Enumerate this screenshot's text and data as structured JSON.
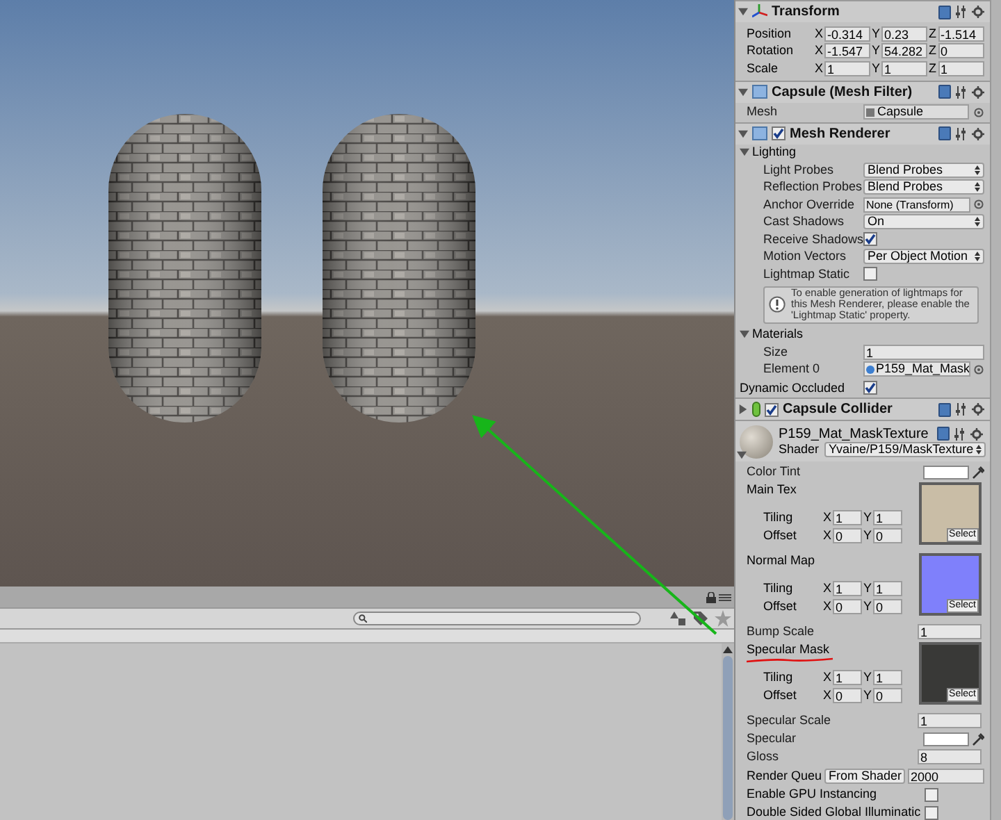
{
  "transform": {
    "title": "Transform",
    "expanded": true,
    "rows": [
      {
        "label": "Position",
        "fields": [
          {
            "axis": "X",
            "value": "-0.314"
          },
          {
            "axis": "Y",
            "value": "0.23"
          },
          {
            "axis": "Z",
            "value": "-1.514"
          }
        ]
      },
      {
        "label": "Rotation",
        "fields": [
          {
            "axis": "X",
            "value": "-1.547"
          },
          {
            "axis": "Y",
            "value": "54.282"
          },
          {
            "axis": "Z",
            "value": "0"
          }
        ]
      },
      {
        "label": "Scale",
        "fields": [
          {
            "axis": "X",
            "value": "1"
          },
          {
            "axis": "Y",
            "value": "1"
          },
          {
            "axis": "Z",
            "value": "1"
          }
        ]
      }
    ]
  },
  "mesh_filter": {
    "title": "Capsule (Mesh Filter)",
    "expanded": true,
    "mesh_label": "Mesh",
    "mesh_value": "Capsule"
  },
  "mesh_renderer": {
    "title": "Mesh Renderer",
    "expanded": true,
    "enabled": true,
    "lighting": {
      "label": "Lighting",
      "expanded": true,
      "props": [
        {
          "kind": "dropdown",
          "label": "Light Probes",
          "value": "Blend Probes"
        },
        {
          "kind": "dropdown",
          "label": "Reflection Probes",
          "value": "Blend Probes"
        },
        {
          "kind": "object",
          "label": "Anchor Override",
          "value": "None (Transform)"
        },
        {
          "kind": "dropdown",
          "label": "Cast Shadows",
          "value": "On"
        },
        {
          "kind": "checkbox",
          "label": "Receive Shadows",
          "checked": true
        },
        {
          "kind": "dropdown",
          "label": "Motion Vectors",
          "value": "Per Object Motion"
        },
        {
          "kind": "checkbox",
          "label": "Lightmap Static",
          "checked": false
        }
      ]
    },
    "info": "To enable generation of lightmaps for this Mesh Renderer, please enable the 'Lightmap Static' property.",
    "materials": {
      "label": "Materials",
      "expanded": true,
      "size_label": "Size",
      "size": "1",
      "element_label": "Element 0",
      "element": "P159_Mat_Mask"
    },
    "dynamic_occluded": {
      "label": "Dynamic Occluded",
      "checked": true
    }
  },
  "capsule_collider": {
    "title": "Capsule Collider",
    "expanded": false,
    "enabled": true
  },
  "material": {
    "name": "P159_Mat_MaskTexture",
    "expanded": true,
    "shader_label": "Shader",
    "shader": "Yvaine/P159/MaskTexture",
    "props": [
      {
        "kind": "color",
        "label": "Color Tint"
      },
      {
        "kind": "texture",
        "label": "Main Tex",
        "color": "#c9bda6",
        "select": "Select",
        "underlined": false,
        "rows": [
          {
            "label": "Tiling",
            "fields": [
              {
                "axis": "X",
                "value": "1"
              },
              {
                "axis": "Y",
                "value": "1"
              }
            ]
          },
          {
            "label": "Offset",
            "fields": [
              {
                "axis": "X",
                "value": "0"
              },
              {
                "axis": "Y",
                "value": "0"
              }
            ]
          }
        ]
      },
      {
        "kind": "texture",
        "label": "Normal Map",
        "color": "#7f80fb",
        "select": "Select",
        "underlined": false,
        "rows": [
          {
            "label": "Tiling",
            "fields": [
              {
                "axis": "X",
                "value": "1"
              },
              {
                "axis": "Y",
                "value": "1"
              }
            ]
          },
          {
            "label": "Offset",
            "fields": [
              {
                "axis": "X",
                "value": "0"
              },
              {
                "axis": "Y",
                "value": "0"
              }
            ]
          }
        ]
      },
      {
        "kind": "number",
        "label": "Bump Scale",
        "value": "1"
      },
      {
        "kind": "texture",
        "label": "Specular Mask",
        "color": "#393937",
        "select": "Select",
        "underlined": true,
        "rows": [
          {
            "label": "Tiling",
            "fields": [
              {
                "axis": "X",
                "value": "1"
              },
              {
                "axis": "Y",
                "value": "1"
              }
            ]
          },
          {
            "label": "Offset",
            "fields": [
              {
                "axis": "X",
                "value": "0"
              },
              {
                "axis": "Y",
                "value": "0"
              }
            ]
          }
        ]
      },
      {
        "kind": "number",
        "label": "Specular Scale",
        "value": "1"
      },
      {
        "kind": "color",
        "label": "Specular"
      },
      {
        "kind": "number",
        "label": "Gloss",
        "value": "8"
      },
      {
        "kind": "queue",
        "label": "Render Queu",
        "mode": "From Shader",
        "value": "2000"
      },
      {
        "kind": "checkbox",
        "label": "Enable GPU Instancing",
        "checked": false
      },
      {
        "kind": "checkbox",
        "label": "Double Sided Global Illuminatic",
        "checked": false
      }
    ]
  }
}
